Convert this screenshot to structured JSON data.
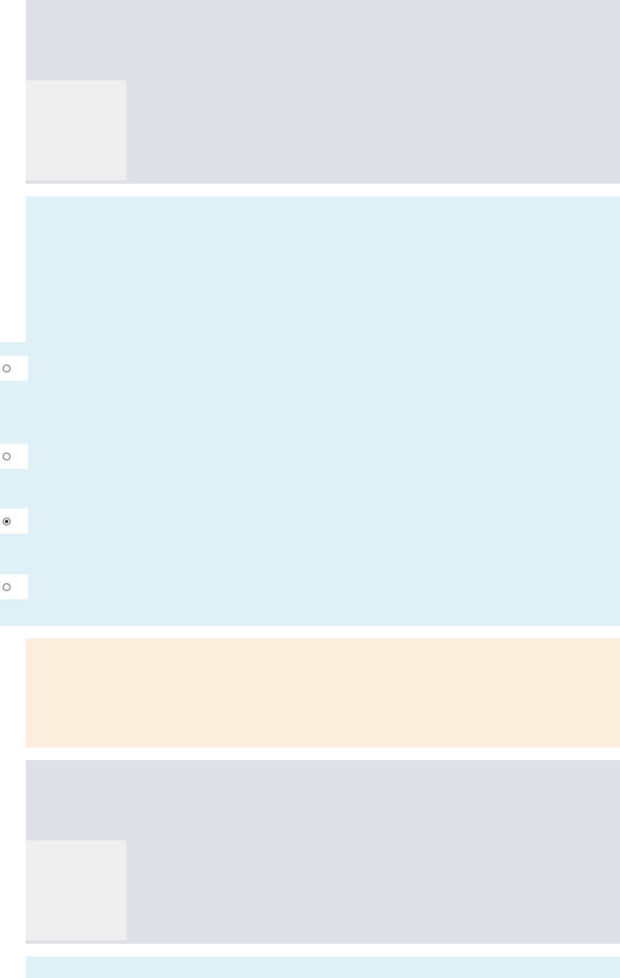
{
  "sections": [
    {
      "kind": "media"
    },
    {
      "kind": "question",
      "options": [
        {
          "selected": false
        },
        {
          "selected": false
        },
        {
          "selected": true
        },
        {
          "selected": false
        }
      ]
    },
    {
      "kind": "note"
    },
    {
      "kind": "media"
    },
    {
      "kind": "question"
    }
  ]
}
